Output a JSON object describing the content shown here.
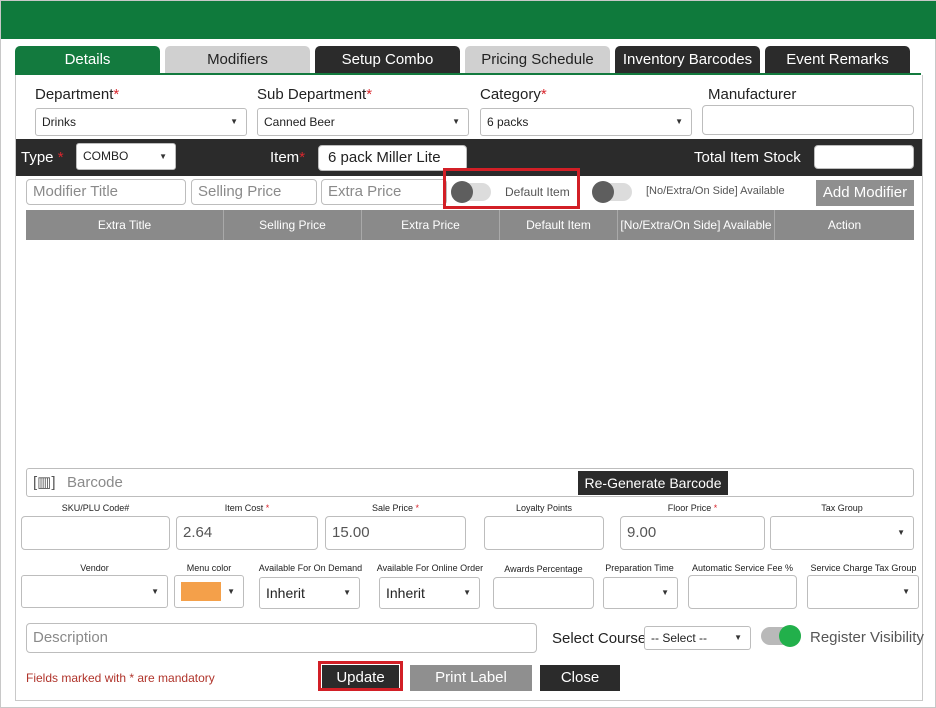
{
  "tabs": [
    {
      "label": "Details"
    },
    {
      "label": "Modifiers"
    },
    {
      "label": "Setup Combo"
    },
    {
      "label": "Pricing Schedule"
    },
    {
      "label": "Inventory Barcodes"
    },
    {
      "label": "Event Remarks"
    }
  ],
  "row1": {
    "department_label": "Department",
    "department_value": "Drinks",
    "subdept_label": "Sub Department",
    "subdept_value": "Canned Beer",
    "category_label": "Category",
    "category_value": "6 packs",
    "manufacturer_label": "Manufacturer",
    "required_mark": "*"
  },
  "typebar": {
    "type_label": "Type",
    "type_value": "COMBO",
    "item_label": "Item",
    "item_value": "6 pack Miller Lite",
    "stock_label": "Total Item Stock"
  },
  "modifier_form": {
    "title_placeholder": "Modifier Title",
    "selling_placeholder": "Selling Price",
    "extra_placeholder": "Extra Price",
    "default_item_label": "Default Item",
    "available_label": "[No/Extra/On Side] Available",
    "add_button": "Add Modifier"
  },
  "table": {
    "columns": [
      "Extra Title",
      "Selling Price",
      "Extra Price",
      "Default Item",
      "[No/Extra/On Side] Available",
      "Action"
    ]
  },
  "barcode": {
    "placeholder": "Barcode",
    "regenerate_button": "Re-Generate Barcode"
  },
  "pricing": {
    "sku_label": "SKU/PLU Code#",
    "item_cost_label": "Item Cost",
    "item_cost_value": "2.64",
    "sale_price_label": "Sale Price",
    "sale_price_value": "15.00",
    "loyalty_label": "Loyalty Points",
    "floor_price_label": "Floor Price",
    "floor_price_value": "9.00",
    "tax_group_label": "Tax Group"
  },
  "options": {
    "vendor_label": "Vendor",
    "menu_color_label": "Menu color",
    "menu_color": "#f4a04a",
    "on_demand_label": "Available For On Demand",
    "on_demand_value": "Inherit",
    "online_order_label": "Available For Online Order",
    "online_order_value": "Inherit",
    "awards_label": "Awards Percentage",
    "prep_time_label": "Preparation Time",
    "auto_fee_label": "Automatic Service Fee %",
    "service_tax_label": "Service Charge Tax Group"
  },
  "bottom": {
    "description_placeholder": "Description",
    "course_label": "Select Course",
    "course_value": "-- Select --",
    "register_visibility_label": "Register Visibility",
    "mandatory_note": "Fields marked with * are mandatory",
    "update_button": "Update",
    "print_button": "Print Label",
    "close_button": "Close"
  },
  "colors": {
    "brand_green": "#137a3e",
    "dark": "#2b2b2b",
    "highlight_red": "#d21f26"
  }
}
